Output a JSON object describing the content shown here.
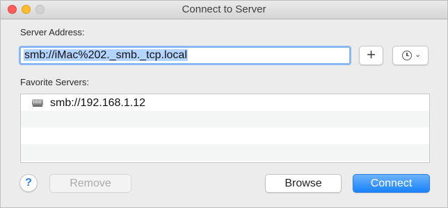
{
  "window": {
    "title": "Connect to Server"
  },
  "server_address": {
    "label": "Server Address:",
    "value": "smb://iMac%202._smb._tcp.local",
    "add_button_label": "+"
  },
  "favorites": {
    "label": "Favorite Servers:",
    "items": [
      {
        "text": "smb://192.168.1.12",
        "icon": "network-drive-icon"
      }
    ]
  },
  "buttons": {
    "help": "?",
    "remove": "Remove",
    "browse": "Browse",
    "connect": "Connect"
  },
  "icons": {
    "history": "clock-icon",
    "history_dropdown": "chevron-down-icon"
  },
  "colors": {
    "accent": "#1a82fb",
    "focus_ring": "#8ab6f2",
    "selection": "#b3d4fe",
    "close": "#fc5f57",
    "minimize": "#fdbc2e"
  }
}
